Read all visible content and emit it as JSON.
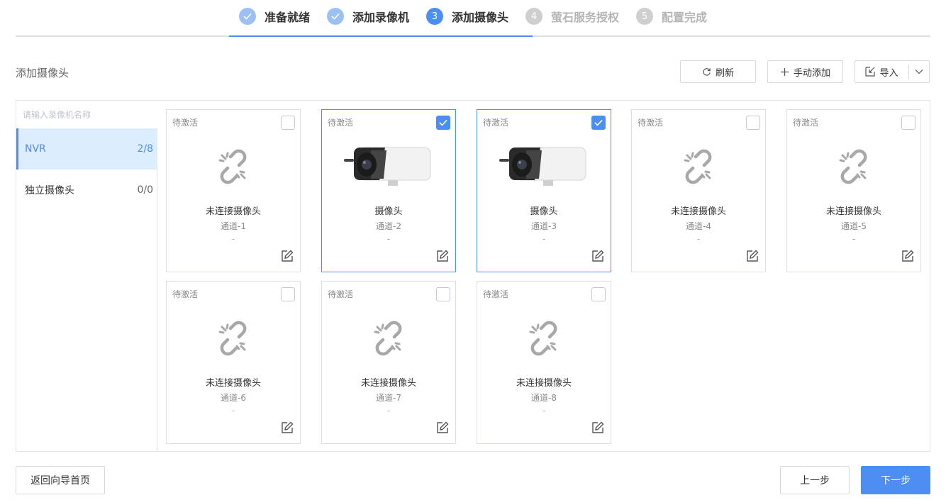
{
  "steps": [
    {
      "num": "1",
      "label": "准备就绪",
      "state": "done"
    },
    {
      "num": "2",
      "label": "添加录像机",
      "state": "done"
    },
    {
      "num": "3",
      "label": "添加摄像头",
      "state": "active"
    },
    {
      "num": "4",
      "label": "萤石服务授权",
      "state": "todo"
    },
    {
      "num": "5",
      "label": "配置完成",
      "state": "todo"
    }
  ],
  "header": {
    "title": "添加摄像头",
    "refresh_label": "刷新",
    "manual_add_label": "手动添加",
    "import_label": "导入"
  },
  "sidebar": {
    "search_placeholder": "请输入录像机名称",
    "items": [
      {
        "label": "NVR",
        "count": "2/8",
        "selected": true
      },
      {
        "label": "独立摄像头",
        "count": "0/0",
        "selected": false
      }
    ]
  },
  "cards": [
    {
      "status": "待激活",
      "name": "未连接摄像头",
      "channel": "通道-1",
      "extra": "-",
      "checked": false,
      "icon": "unlinked-icon"
    },
    {
      "status": "待激活",
      "name": "摄像头",
      "channel": "通道-2",
      "extra": "-",
      "checked": true,
      "icon": "camera-image"
    },
    {
      "status": "待激活",
      "name": "摄像头",
      "channel": "通道-3",
      "extra": "-",
      "checked": true,
      "icon": "camera-image"
    },
    {
      "status": "待激活",
      "name": "未连接摄像头",
      "channel": "通道-4",
      "extra": "-",
      "checked": false,
      "icon": "unlinked-icon"
    },
    {
      "status": "待激活",
      "name": "未连接摄像头",
      "channel": "通道-5",
      "extra": "-",
      "checked": false,
      "icon": "unlinked-icon"
    },
    {
      "status": "待激活",
      "name": "未连接摄像头",
      "channel": "通道-6",
      "extra": "-",
      "checked": false,
      "icon": "unlinked-icon"
    },
    {
      "status": "待激活",
      "name": "未连接摄像头",
      "channel": "通道-7",
      "extra": "-",
      "checked": false,
      "icon": "unlinked-icon"
    },
    {
      "status": "待激活",
      "name": "未连接摄像头",
      "channel": "通道-8",
      "extra": "-",
      "checked": false,
      "icon": "unlinked-icon"
    }
  ],
  "footer": {
    "home_label": "返回向导首页",
    "prev_label": "上一步",
    "next_label": "下一步"
  },
  "colors": {
    "accent": "#4d8ef3",
    "accent_light": "#9cc0f5",
    "selected_bg": "#dcedfd",
    "inactive_step": "#cfcfcf"
  }
}
